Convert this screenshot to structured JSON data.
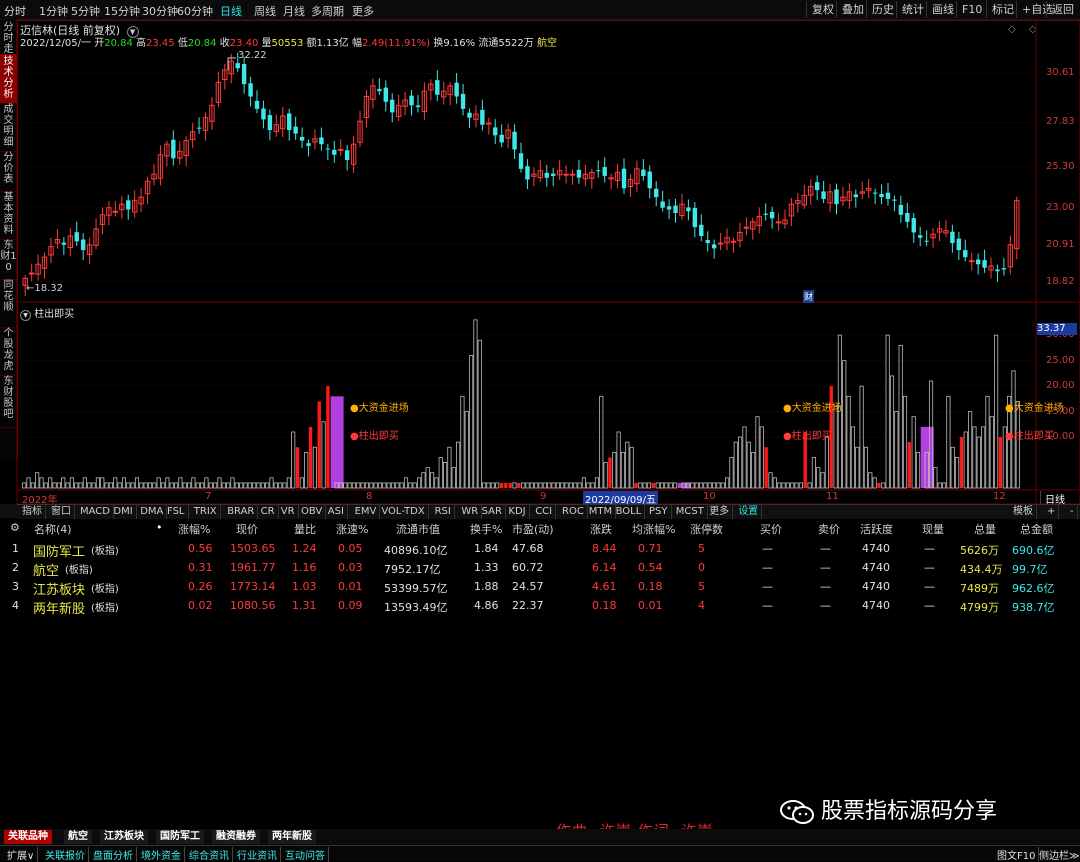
{
  "top_bar": {
    "periods": [
      "分时",
      "1分钟",
      "5分钟",
      "15分钟",
      "30分钟",
      "60分钟",
      "日线",
      "周线",
      "月线",
      "多周期",
      "更多"
    ],
    "active_period": "日线",
    "right_buttons": [
      "复权",
      "叠加",
      "历史",
      "统计",
      "画线",
      "F10",
      "标记",
      "+自选",
      "返回"
    ]
  },
  "left_tabs": [
    "分时走势",
    "技术分析",
    "成交明细",
    "分价表",
    "基本资料",
    "东财10",
    "同花顺",
    "个股龙虎",
    "东财股吧"
  ],
  "stock": {
    "title": "迈信林(日线 前复权)",
    "date": "2022/12/05/一",
    "open_label": "开",
    "open": "20.84",
    "high_label": "高",
    "high": "23.45",
    "low_label": "低",
    "low": "20.84",
    "close_label": "收",
    "close": "23.40",
    "vol_label": "量",
    "volume": "50553",
    "amount_label": "额",
    "amount": "1.13亿",
    "change_label": "幅",
    "change": "2.49(11.91%)",
    "turnover_label": "换",
    "turnover": "9.16%",
    "float_label": "流通",
    "float": "5522万",
    "sector": "航空"
  },
  "price_axis": [
    "30.61",
    "27.83",
    "25.30",
    "23.00",
    "20.91",
    "18.82"
  ],
  "annotations": {
    "max_price": "32.22",
    "min_price": "18.32",
    "news_marker": "财"
  },
  "indicator": {
    "name": "柱出即买",
    "current_value": "33.37",
    "axis": [
      "30.00",
      "25.00",
      "20.00",
      "15.00",
      "10.00"
    ],
    "signal_big_fund": "大资金进场",
    "signal_buy": "柱出即买"
  },
  "time_axis": {
    "labels": [
      "2022年",
      "7",
      "8",
      "9",
      "2022/09/09/五",
      "10",
      "11",
      "12"
    ],
    "right_button": "日线"
  },
  "indicator_tabs": [
    "指标",
    "窗口",
    "MACD",
    "DMI",
    "DMA",
    "FSL",
    "TRIX",
    "BRAR",
    "CR",
    "VR",
    "OBV",
    "ASI",
    "EMV",
    "VOL-TDX",
    "RSI",
    "WR",
    "SAR",
    "KDJ",
    "CCI",
    "ROC",
    "MTM",
    "BOLL",
    "PSY",
    "MCST",
    "更多",
    "设置"
  ],
  "indicator_tabs_right": [
    "模板",
    "+",
    "-"
  ],
  "table": {
    "columns": [
      "名称(4)",
      "涨幅%",
      "现价",
      "量比",
      "涨速%",
      "流通市值",
      "换手%",
      "市盈(动)",
      "涨跌",
      "均涨幅%",
      "涨停数",
      "买价",
      "卖价",
      "活跃度",
      "现量",
      "总量",
      "总金额"
    ],
    "rows": [
      {
        "idx": "1",
        "name": "国防军工",
        "type": "(板指)",
        "chg": "0.56",
        "price": "1503.65",
        "vr": "1.24",
        "speed": "0.05",
        "mcap": "40896.10亿",
        "turn": "1.84",
        "pe": "47.68",
        "diff": "8.44",
        "avg": "0.71",
        "limit": "5",
        "bid": "—",
        "ask": "—",
        "act": "4740",
        "cur": "—",
        "vol": "5626万",
        "amt": "690.6亿"
      },
      {
        "idx": "2",
        "name": "航空",
        "type": "(板指)",
        "chg": "0.31",
        "price": "1961.77",
        "vr": "1.16",
        "speed": "0.03",
        "mcap": "7952.17亿",
        "turn": "1.33",
        "pe": "60.72",
        "diff": "6.14",
        "avg": "0.54",
        "limit": "0",
        "bid": "—",
        "ask": "—",
        "act": "4740",
        "cur": "—",
        "vol": "434.4万",
        "amt": "99.7亿"
      },
      {
        "idx": "3",
        "name": "江苏板块",
        "type": "(板指)",
        "chg": "0.26",
        "price": "1773.14",
        "vr": "1.03",
        "speed": "0.01",
        "mcap": "53399.57亿",
        "turn": "1.88",
        "pe": "24.57",
        "diff": "4.61",
        "avg": "0.18",
        "limit": "5",
        "bid": "—",
        "ask": "—",
        "act": "4740",
        "cur": "—",
        "vol": "7489万",
        "amt": "962.6亿"
      },
      {
        "idx": "4",
        "name": "两年新股",
        "type": "(板指)",
        "chg": "0.02",
        "price": "1080.56",
        "vr": "1.31",
        "speed": "0.09",
        "mcap": "13593.49亿",
        "turn": "4.86",
        "pe": "22.37",
        "diff": "0.18",
        "avg": "0.01",
        "limit": "4",
        "bid": "—",
        "ask": "—",
        "act": "4740",
        "cur": "—",
        "vol": "4799万",
        "amt": "938.7亿"
      }
    ]
  },
  "bottom_tabs": [
    "关联品种",
    "航空",
    "江苏板块",
    "国防军工",
    "融资融券",
    "两年新股"
  ],
  "status_bar": [
    "扩展∨",
    "关联报价",
    "盘面分析",
    "境外资金",
    "综合资讯",
    "行业资讯",
    "互动问答"
  ],
  "status_right": [
    "图文F10",
    "侧边栏≫"
  ],
  "watermark": "股票指标源码分享",
  "credit": "作曲: 许嵩 作词: 许嵩",
  "colors": {
    "up": "#ff3b3b",
    "down": "#3fe8e8",
    "accent": "#2ee3e3",
    "panel_border": "#6b0000",
    "signal": "#b040e0"
  },
  "chart_data": [
    {
      "type": "candlestick",
      "title": "迈信林(日线 前复权)",
      "x_range": [
        "2022/06",
        "2022/12/05"
      ],
      "ylim": [
        18.32,
        32.22
      ],
      "y_ticks": [
        18.82,
        20.91,
        23.0,
        25.3,
        27.83,
        30.61
      ],
      "max": 32.22,
      "min": 18.32,
      "closes": [
        19.0,
        19.3,
        19.8,
        20.2,
        20.8,
        21.2,
        20.9,
        21.4,
        21.1,
        20.6,
        20.9,
        21.8,
        22.6,
        23.0,
        22.8,
        23.2,
        22.9,
        23.4,
        23.6,
        24.5,
        24.9,
        26.0,
        26.6,
        25.8,
        26.2,
        26.8,
        27.3,
        27.5,
        28.1,
        28.8,
        30.1,
        30.8,
        31.3,
        30.9,
        30.0,
        29.3,
        28.6,
        28.0,
        27.4,
        27.7,
        28.2,
        27.4,
        27.2,
        26.8,
        26.5,
        26.9,
        26.6,
        26.3,
        26.0,
        26.3,
        25.7,
        26.6,
        27.9,
        29.3,
        29.9,
        29.6,
        29.0,
        28.4,
        28.8,
        29.1,
        28.8,
        28.7,
        29.6,
        30.0,
        29.4,
        29.6,
        29.9,
        29.3,
        28.6,
        28.1,
        28.3,
        27.7,
        27.8,
        27.1,
        26.7,
        27.4,
        26.3,
        25.2,
        24.6,
        24.9,
        25.1,
        24.7,
        24.8,
        25.1,
        24.9,
        24.9,
        24.7,
        24.9,
        25.0,
        25.1,
        24.8,
        24.7,
        25.0,
        24.1,
        24.6,
        25.2,
        24.8,
        24.1,
        23.6,
        23.0,
        22.9,
        22.7,
        23.2,
        22.8,
        21.9,
        21.4,
        21.0,
        20.7,
        21.0,
        21.3,
        21.1,
        21.6,
        21.9,
        22.2,
        22.5,
        22.6,
        22.4,
        22.2,
        22.3,
        23.2,
        23.4,
        23.7,
        24.2,
        24.0,
        23.5,
        23.9,
        23.2,
        23.6,
        23.9,
        23.6,
        23.9,
        24.1,
        23.8,
        23.6,
        23.5,
        23.4,
        22.6,
        22.2,
        21.6,
        21.3,
        21.1,
        21.5,
        21.8,
        21.7,
        21.0,
        20.6,
        20.2,
        20.0,
        19.8,
        19.6,
        19.7,
        19.4,
        19.5,
        20.9,
        23.4
      ]
    },
    {
      "type": "bar",
      "title": "柱出即买",
      "ylim": [
        0,
        33.37
      ],
      "y_ticks": [
        10,
        15,
        20,
        25,
        30
      ],
      "values": [
        1,
        2,
        1,
        3,
        2,
        1,
        2,
        1,
        1,
        2,
        1,
        2,
        1,
        1,
        2,
        1,
        1,
        2,
        2,
        1,
        1,
        2,
        1,
        2,
        1,
        1,
        2,
        1,
        1,
        1,
        1,
        2,
        1,
        2,
        1,
        1,
        2,
        1,
        1,
        2,
        1,
        1,
        2,
        1,
        1,
        2,
        1,
        1,
        2,
        1,
        1,
        1,
        1,
        1,
        1,
        1,
        1,
        2,
        1,
        1,
        1,
        2,
        11,
        8,
        2,
        7,
        12,
        8,
        17,
        13,
        20,
        18,
        1,
        1,
        1,
        1,
        1,
        1,
        1,
        1,
        1,
        1,
        1,
        1,
        1,
        1,
        1,
        1,
        2,
        1,
        1,
        2,
        3,
        4,
        3,
        2,
        6,
        5,
        8,
        4,
        9,
        18,
        15,
        26,
        33,
        29,
        1,
        1,
        1,
        1,
        1,
        1,
        1,
        1,
        1,
        1,
        1,
        1,
        1,
        1,
        1,
        1,
        1,
        1,
        1,
        1,
        1,
        1,
        1,
        2,
        1,
        1,
        2,
        18,
        5,
        6,
        7,
        11,
        7,
        9,
        8,
        1,
        1,
        1,
        1,
        1,
        1,
        1,
        1,
        1,
        1,
        1,
        1,
        1,
        1,
        1,
        1,
        1,
        1,
        1,
        1,
        1,
        2,
        6,
        9,
        10,
        12,
        9,
        7,
        14,
        12,
        8,
        3,
        2,
        1,
        1,
        1,
        1,
        1,
        1,
        11,
        1,
        6,
        4,
        3,
        10,
        20,
        16,
        30,
        25,
        18,
        12,
        8,
        20,
        8,
        3,
        2,
        1,
        1,
        30,
        22,
        15,
        28,
        18,
        9,
        14,
        7,
        12,
        7,
        21,
        4,
        1,
        1,
        18,
        8,
        6,
        10,
        11,
        15,
        12,
        10,
        12,
        18,
        14,
        30,
        10,
        12,
        18,
        23,
        17
      ],
      "colors": [
        "gray",
        "red",
        "purple"
      ]
    }
  ]
}
